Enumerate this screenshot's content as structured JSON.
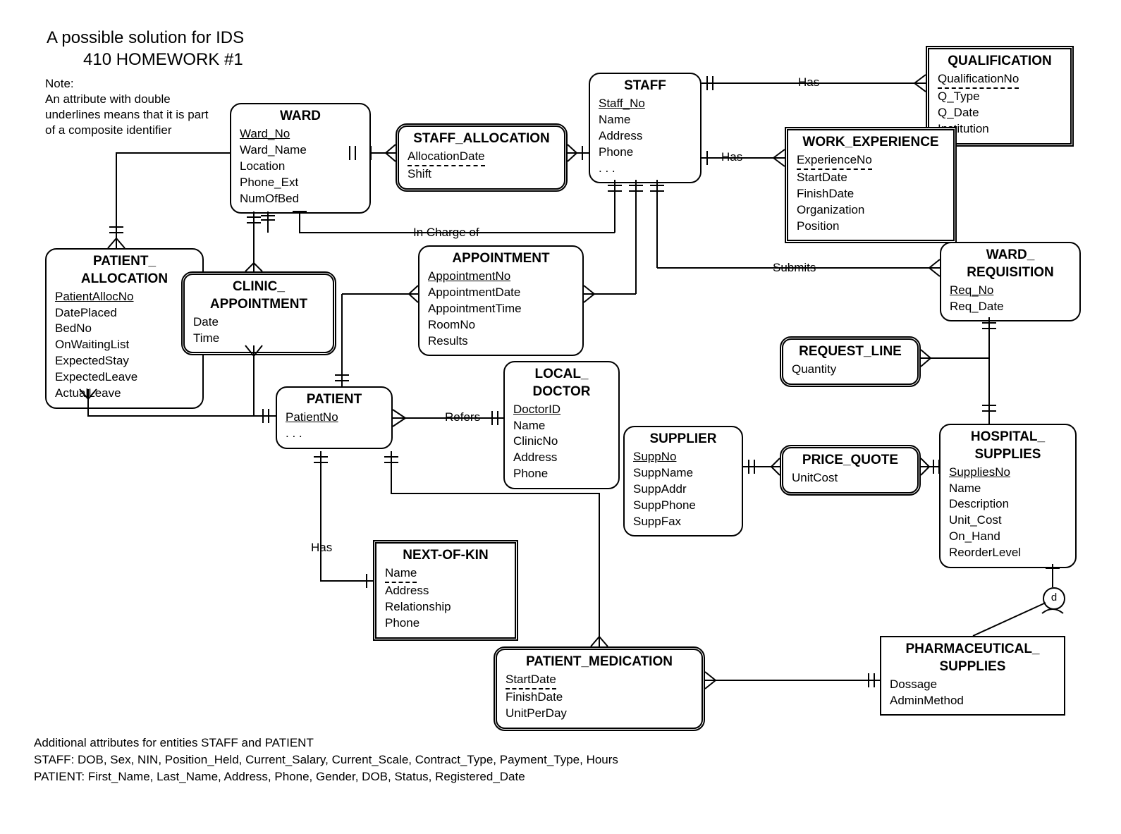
{
  "heading": {
    "line1": "A possible solution for IDS",
    "line2": "410 HOMEWORK #1"
  },
  "note": {
    "label": "Note:",
    "line1": "An attribute with double",
    "line2": "underlines  means that it is part",
    "line3": "of a composite identifier"
  },
  "footer": {
    "line1": "Additional attributes for entities STAFF and PATIENT",
    "line2": "STAFF: DOB, Sex, NIN, Position_Held, Current_Salary, Current_Scale, Contract_Type, Payment_Type, Hours",
    "line3": "PATIENT: First_Name, Last_Name, Address, Phone, Gender, DOB, Status, Registered_Date"
  },
  "entities": {
    "ward": {
      "name": "WARD",
      "attrs": [
        "Ward_No",
        "Ward_Name",
        "Location",
        "Phone_Ext",
        "NumOfBed"
      ],
      "pk": [
        0
      ]
    },
    "staff_alloc": {
      "name": "STAFF_ALLOCATION",
      "attrs": [
        "AllocationDate",
        "Shift"
      ],
      "partial": [
        0
      ]
    },
    "staff": {
      "name": "STAFF",
      "attrs": [
        "Staff_No",
        "Name",
        "Address",
        "Phone",
        ". . ."
      ],
      "pk": [
        0
      ]
    },
    "qualif": {
      "name": "QUALIFICATION",
      "attrs": [
        "QualificationNo",
        "Q_Type",
        "Q_Date",
        "Institution"
      ],
      "partial": [
        0
      ]
    },
    "workexp": {
      "name": "WORK_EXPERIENCE",
      "attrs": [
        "ExperienceNo",
        "StartDate",
        "FinishDate",
        "Organization",
        "Position"
      ],
      "partial": [
        0
      ]
    },
    "pat_alloc": {
      "name": "PATIENT_",
      "name2": "ALLOCATION",
      "attrs": [
        "PatientAllocNo",
        "DatePlaced",
        "BedNo",
        "OnWaitingList",
        "ExpectedStay",
        "ExpectedLeave",
        "ActualLeave"
      ],
      "pk": [
        0
      ]
    },
    "clinic_appt": {
      "name": "CLINIC_",
      "name2": "APPOINTMENT",
      "attrs": [
        "Date",
        "Time"
      ]
    },
    "appointment": {
      "name": "APPOINTMENT",
      "attrs": [
        "AppointmentNo",
        "AppointmentDate",
        "AppointmentTime",
        "RoomNo",
        "Results"
      ],
      "pk": [
        0
      ]
    },
    "ward_req": {
      "name": "WARD_",
      "name2": "REQUISITION",
      "attrs": [
        "Req_No",
        "Req_Date"
      ],
      "pk": [
        0
      ]
    },
    "request_line": {
      "name": "REQUEST_LINE",
      "attrs": [
        "Quantity"
      ]
    },
    "patient": {
      "name": "PATIENT",
      "attrs": [
        "PatientNo",
        ". . ."
      ],
      "pk": [
        0
      ]
    },
    "local_doc": {
      "name": "LOCAL_",
      "name2": "DOCTOR",
      "attrs": [
        "DoctorID",
        "Name",
        "ClinicNo",
        "Address",
        "Phone"
      ],
      "pk": [
        0
      ]
    },
    "supplier": {
      "name": "SUPPLIER",
      "attrs": [
        "SuppNo",
        "SuppName",
        "SuppAddr",
        "SuppPhone",
        "SuppFax"
      ],
      "pk": [
        0
      ]
    },
    "price_quote": {
      "name": "PRICE_QUOTE",
      "attrs": [
        "UnitCost"
      ]
    },
    "hosp_supp": {
      "name": "HOSPITAL_",
      "name2": "SUPPLIES",
      "attrs": [
        "SuppliesNo",
        "Name",
        "Description",
        "Unit_Cost",
        "On_Hand",
        "ReorderLevel"
      ],
      "pk": [
        0
      ]
    },
    "next_of_kin": {
      "name": "NEXT-OF-KIN",
      "attrs": [
        "Name",
        "Address",
        "Relationship",
        "Phone"
      ],
      "partial": [
        0
      ]
    },
    "pat_med": {
      "name": "PATIENT_MEDICATION",
      "attrs": [
        "StartDate",
        "FinishDate",
        "UnitPerDay"
      ],
      "partial": [
        0
      ]
    },
    "pharm_supp": {
      "name": "PHARMACEUTICAL_",
      "name2": "SUPPLIES",
      "attrs": [
        "Dossage",
        "AdminMethod"
      ]
    }
  },
  "rel_labels": {
    "has_qual": "Has",
    "has_exp": "Has",
    "in_charge": "In Charge of",
    "submits": "Submits",
    "refers": "Refers",
    "has_nok": "Has",
    "d": "d"
  }
}
